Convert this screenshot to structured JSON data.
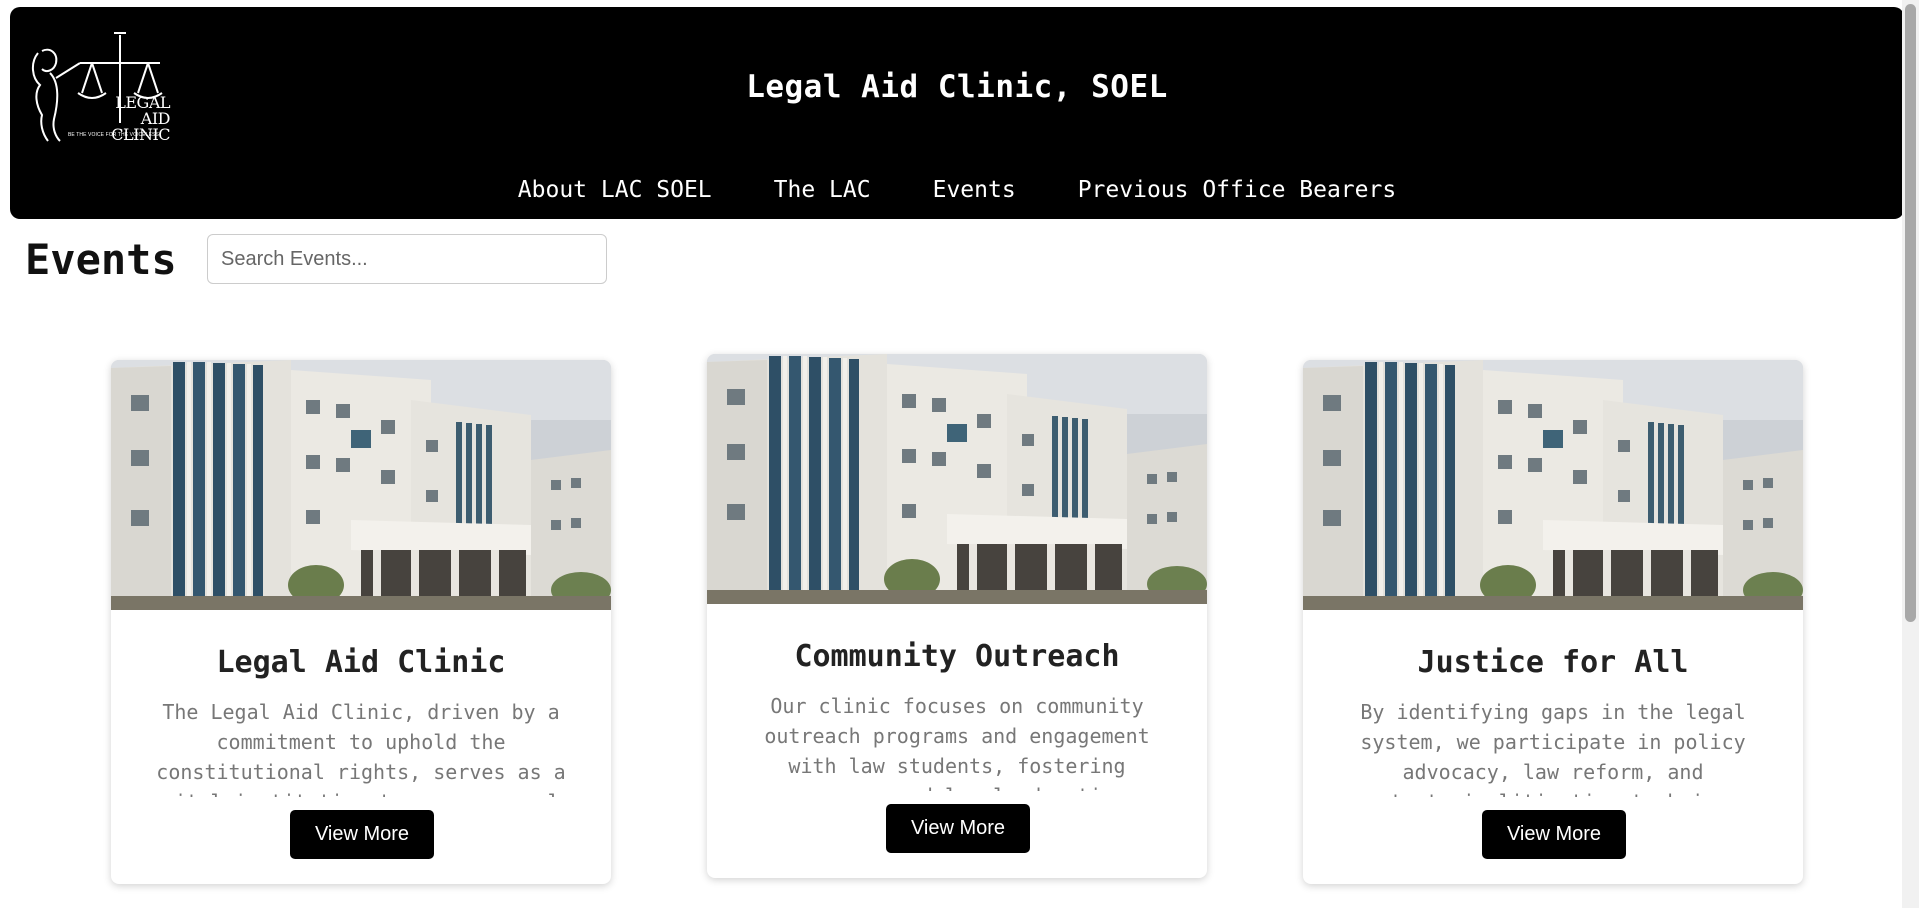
{
  "header": {
    "site_title": "Legal Aid Clinic, SOEL",
    "logo": {
      "icon": "lady-justice-scales-icon",
      "line1": "LEGAL AID",
      "line2": "CLINIC",
      "tagline": "BE THE VOICE FOR THE VOICELESS"
    },
    "nav": [
      {
        "label": "About LAC SOEL"
      },
      {
        "label": "The LAC"
      },
      {
        "label": "Events"
      },
      {
        "label": "Previous Office Bearers"
      }
    ]
  },
  "main": {
    "heading": "Events",
    "search": {
      "placeholder": "Search Events...",
      "value": ""
    },
    "cards": [
      {
        "image": "building-photo",
        "title": "Legal Aid Clinic",
        "description": "The Legal Aid Clinic, driven by a commitment to uphold the constitutional rights, serves as a vital institution to ensure equal access to justice.",
        "button": "View More"
      },
      {
        "image": "building-photo",
        "title": "Community Outreach",
        "description": "Our clinic focuses on community outreach programs and engagement with law students, fostering awareness and legal education.",
        "button": "View More"
      },
      {
        "image": "building-photo",
        "title": "Justice for All",
        "description": "By identifying gaps in the legal system, we participate in policy advocacy, law reform, and strategic litigation to bring about change.",
        "button": "View More"
      }
    ]
  },
  "colors": {
    "header_bg": "#000000",
    "button_bg": "#000000",
    "text_muted": "#777777"
  }
}
